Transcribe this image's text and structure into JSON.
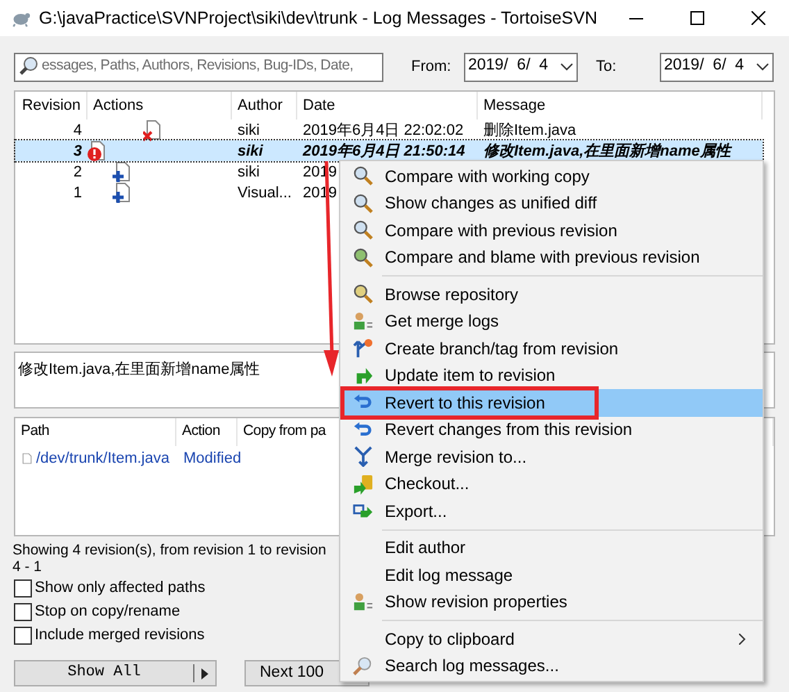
{
  "window": {
    "title": "G:\\javaPractice\\SVNProject\\siki\\dev\\trunk - Log Messages - TortoiseSVN"
  },
  "filter": {
    "placeholder": "essages, Paths, Authors, Revisions, Bug-IDs, Date,",
    "from_label": "From:",
    "from": "2019/  6/  4",
    "to_label": "To:",
    "to": "2019/  6/  4"
  },
  "log": {
    "columns": [
      "Revision",
      "Actions",
      "Author",
      "Date",
      "Message"
    ],
    "rows": [
      {
        "revision": "4",
        "kind": "deleted",
        "author": "siki",
        "date": "2019年6月4日 22:02:02",
        "message": "删除Item.java",
        "selected": false
      },
      {
        "revision": "3",
        "kind": "modified",
        "author": "siki",
        "date": "2019年6月4日 21:50:14",
        "message": "修改Item.java,在里面新增name属性",
        "selected": true
      },
      {
        "revision": "2",
        "kind": "added",
        "author": "siki",
        "date": "2019",
        "selected": false
      },
      {
        "revision": "1",
        "kind": "added",
        "author": "Visual...",
        "date": "2019",
        "selected": false
      }
    ]
  },
  "message_text": "修改Item.java,在里面新增name属性",
  "paths": {
    "columns": [
      "Path",
      "Action",
      "Copy from pa"
    ],
    "rows": [
      {
        "path": "/dev/trunk/Item.java",
        "action": "Modified"
      }
    ]
  },
  "status": "Showing 4 revision(s), from revision 1 to revision 4 - 1",
  "options": [
    {
      "label": "Show only affected paths",
      "checked": false
    },
    {
      "label": "Stop on copy/rename",
      "checked": false
    },
    {
      "label": "Include merged revisions",
      "checked": false
    }
  ],
  "buttons": {
    "show_all": "Show All",
    "next": "Next 100"
  },
  "context_menu": [
    [
      {
        "label": "Compare with working copy",
        "selected": false
      },
      {
        "label": "Show changes as unified diff",
        "selected": false
      },
      {
        "label": "Compare with previous revision",
        "selected": false
      },
      {
        "label": "Compare and blame with previous revision",
        "selected": false
      }
    ],
    [
      {
        "label": "Browse repository",
        "selected": false
      },
      {
        "label": "Get merge logs",
        "selected": false
      },
      {
        "label": "Create branch/tag from revision",
        "selected": false
      },
      {
        "label": "Update item to revision",
        "selected": false
      },
      {
        "label": "Revert to this revision",
        "selected": true,
        "outlined": true
      },
      {
        "label": "Revert changes from this revision",
        "selected": false
      },
      {
        "label": "Merge revision to...",
        "selected": false
      },
      {
        "label": "Checkout...",
        "selected": false
      },
      {
        "label": "Export...",
        "selected": false
      }
    ],
    [
      {
        "label": "Edit author",
        "selected": false
      },
      {
        "label": "Edit log message",
        "selected": false
      },
      {
        "label": "Show revision properties",
        "selected": false
      }
    ],
    [
      {
        "label": "Copy to clipboard",
        "selected": false,
        "submenu": true
      },
      {
        "label": "Search log messages...",
        "selected": false
      }
    ]
  ]
}
